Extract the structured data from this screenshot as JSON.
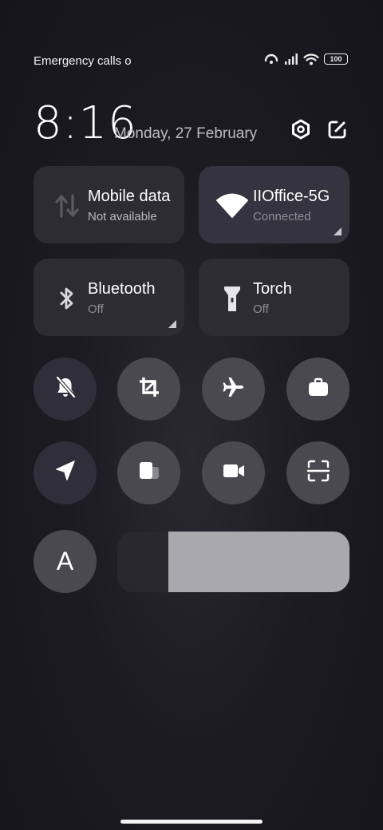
{
  "status_bar": {
    "text": "Emergency calls o",
    "battery": "100",
    "icons": [
      "hotspot-icon",
      "signal-icon",
      "wifi-icon",
      "battery-icon"
    ]
  },
  "header": {
    "time": "8:16",
    "date": "Monday, 27 February",
    "settings_icon": "settings-icon",
    "edit_icon": "edit-icon"
  },
  "tiles": [
    {
      "title": "Mobile data",
      "subtitle": "Not available",
      "icon": "mobile-data-icon",
      "active": false
    },
    {
      "title": "IIOffice-5G",
      "subtitle": "Connected",
      "icon": "wifi-icon",
      "active": true
    },
    {
      "title": "Bluetooth",
      "subtitle": "Off",
      "icon": "bluetooth-icon",
      "active": false
    },
    {
      "title": "Torch",
      "subtitle": "Off",
      "icon": "torch-icon",
      "active": false
    }
  ],
  "toggles": [
    {
      "name": "silent",
      "icon": "bell-off-icon",
      "active": true
    },
    {
      "name": "screenshot",
      "icon": "crop-icon",
      "active": false
    },
    {
      "name": "airplane-mode",
      "icon": "airplane-icon",
      "active": false
    },
    {
      "name": "work-mode",
      "icon": "briefcase-icon",
      "active": false
    },
    {
      "name": "location",
      "icon": "location-arrow-icon",
      "active": true
    },
    {
      "name": "floating-window",
      "icon": "floating-window-icon",
      "active": false
    },
    {
      "name": "screen-recorder",
      "icon": "video-camera-icon",
      "active": false
    },
    {
      "name": "scanner",
      "icon": "scan-icon",
      "active": false
    }
  ],
  "font_button": {
    "label": "A"
  },
  "brightness": {
    "level": 0.78
  },
  "colors": {
    "background": "#1c1b22",
    "tile": "#2d2c32",
    "tile_active": "#35333f",
    "toggle": "#4a494f",
    "toggle_active": "#302e3b",
    "slider_fill": "#a9a9ad"
  }
}
